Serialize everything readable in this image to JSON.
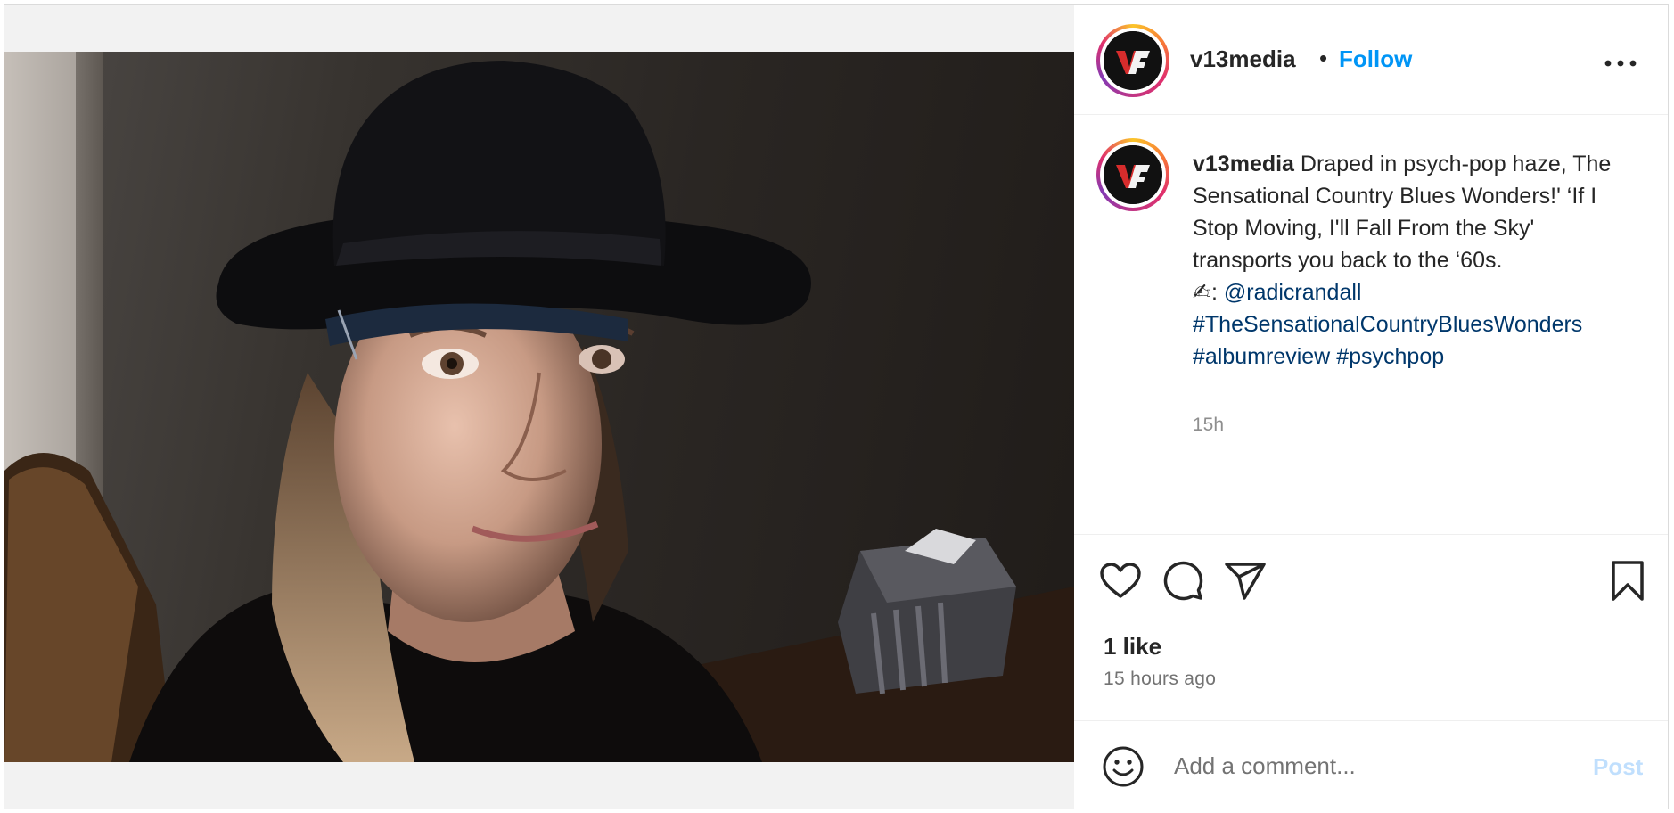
{
  "post": {
    "username": "v13media",
    "separator": "•",
    "follow_label": "Follow",
    "avatar_text": "V13",
    "more_icon": "more-horizontal-icon"
  },
  "caption": {
    "username": "v13media",
    "text": " Draped in psych-pop haze, The Sensational Country Blues Wonders!' ‘If I Stop Moving, I'll Fall From the Sky' transports you back to the ‘60s.",
    "writer_emoji": "✍",
    "writer_sep": ": ",
    "mention": "@radicrandall",
    "hashtags": [
      "#TheSensationalCountryBluesWonders",
      "#albumreview",
      "#psychpop"
    ],
    "time": "15h"
  },
  "actions": {
    "icons": [
      "heart-icon",
      "comment-icon",
      "share-icon",
      "bookmark-icon"
    ]
  },
  "likes": {
    "count_text": "1 like",
    "time_ago": "15 hours ago"
  },
  "comment_box": {
    "placeholder": "Add a comment...",
    "post_label": "Post"
  },
  "colors": {
    "accent": "#0095f6",
    "link": "#00376b",
    "post_disabled": "#c0dffd",
    "text": "#262626",
    "muted": "#737373"
  }
}
